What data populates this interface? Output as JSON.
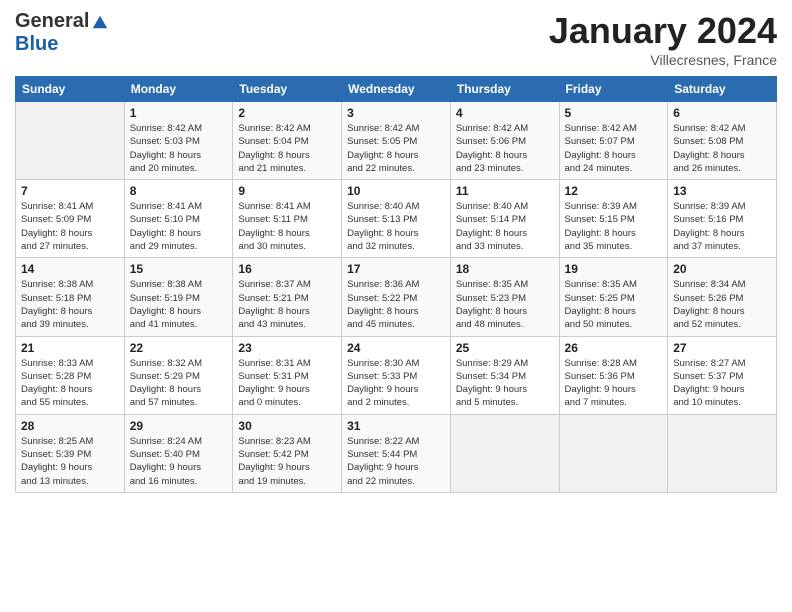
{
  "header": {
    "logo_general": "General",
    "logo_blue": "Blue",
    "month_title": "January 2024",
    "location": "Villecresnes, France"
  },
  "days_of_week": [
    "Sunday",
    "Monday",
    "Tuesday",
    "Wednesday",
    "Thursday",
    "Friday",
    "Saturday"
  ],
  "weeks": [
    {
      "days": [
        {
          "number": "",
          "info": ""
        },
        {
          "number": "1",
          "info": "Sunrise: 8:42 AM\nSunset: 5:03 PM\nDaylight: 8 hours\nand 20 minutes."
        },
        {
          "number": "2",
          "info": "Sunrise: 8:42 AM\nSunset: 5:04 PM\nDaylight: 8 hours\nand 21 minutes."
        },
        {
          "number": "3",
          "info": "Sunrise: 8:42 AM\nSunset: 5:05 PM\nDaylight: 8 hours\nand 22 minutes."
        },
        {
          "number": "4",
          "info": "Sunrise: 8:42 AM\nSunset: 5:06 PM\nDaylight: 8 hours\nand 23 minutes."
        },
        {
          "number": "5",
          "info": "Sunrise: 8:42 AM\nSunset: 5:07 PM\nDaylight: 8 hours\nand 24 minutes."
        },
        {
          "number": "6",
          "info": "Sunrise: 8:42 AM\nSunset: 5:08 PM\nDaylight: 8 hours\nand 26 minutes."
        }
      ]
    },
    {
      "days": [
        {
          "number": "7",
          "info": "Sunrise: 8:41 AM\nSunset: 5:09 PM\nDaylight: 8 hours\nand 27 minutes."
        },
        {
          "number": "8",
          "info": "Sunrise: 8:41 AM\nSunset: 5:10 PM\nDaylight: 8 hours\nand 29 minutes."
        },
        {
          "number": "9",
          "info": "Sunrise: 8:41 AM\nSunset: 5:11 PM\nDaylight: 8 hours\nand 30 minutes."
        },
        {
          "number": "10",
          "info": "Sunrise: 8:40 AM\nSunset: 5:13 PM\nDaylight: 8 hours\nand 32 minutes."
        },
        {
          "number": "11",
          "info": "Sunrise: 8:40 AM\nSunset: 5:14 PM\nDaylight: 8 hours\nand 33 minutes."
        },
        {
          "number": "12",
          "info": "Sunrise: 8:39 AM\nSunset: 5:15 PM\nDaylight: 8 hours\nand 35 minutes."
        },
        {
          "number": "13",
          "info": "Sunrise: 8:39 AM\nSunset: 5:16 PM\nDaylight: 8 hours\nand 37 minutes."
        }
      ]
    },
    {
      "days": [
        {
          "number": "14",
          "info": "Sunrise: 8:38 AM\nSunset: 5:18 PM\nDaylight: 8 hours\nand 39 minutes."
        },
        {
          "number": "15",
          "info": "Sunrise: 8:38 AM\nSunset: 5:19 PM\nDaylight: 8 hours\nand 41 minutes."
        },
        {
          "number": "16",
          "info": "Sunrise: 8:37 AM\nSunset: 5:21 PM\nDaylight: 8 hours\nand 43 minutes."
        },
        {
          "number": "17",
          "info": "Sunrise: 8:36 AM\nSunset: 5:22 PM\nDaylight: 8 hours\nand 45 minutes."
        },
        {
          "number": "18",
          "info": "Sunrise: 8:35 AM\nSunset: 5:23 PM\nDaylight: 8 hours\nand 48 minutes."
        },
        {
          "number": "19",
          "info": "Sunrise: 8:35 AM\nSunset: 5:25 PM\nDaylight: 8 hours\nand 50 minutes."
        },
        {
          "number": "20",
          "info": "Sunrise: 8:34 AM\nSunset: 5:26 PM\nDaylight: 8 hours\nand 52 minutes."
        }
      ]
    },
    {
      "days": [
        {
          "number": "21",
          "info": "Sunrise: 8:33 AM\nSunset: 5:28 PM\nDaylight: 8 hours\nand 55 minutes."
        },
        {
          "number": "22",
          "info": "Sunrise: 8:32 AM\nSunset: 5:29 PM\nDaylight: 8 hours\nand 57 minutes."
        },
        {
          "number": "23",
          "info": "Sunrise: 8:31 AM\nSunset: 5:31 PM\nDaylight: 9 hours\nand 0 minutes."
        },
        {
          "number": "24",
          "info": "Sunrise: 8:30 AM\nSunset: 5:33 PM\nDaylight: 9 hours\nand 2 minutes."
        },
        {
          "number": "25",
          "info": "Sunrise: 8:29 AM\nSunset: 5:34 PM\nDaylight: 9 hours\nand 5 minutes."
        },
        {
          "number": "26",
          "info": "Sunrise: 8:28 AM\nSunset: 5:36 PM\nDaylight: 9 hours\nand 7 minutes."
        },
        {
          "number": "27",
          "info": "Sunrise: 8:27 AM\nSunset: 5:37 PM\nDaylight: 9 hours\nand 10 minutes."
        }
      ]
    },
    {
      "days": [
        {
          "number": "28",
          "info": "Sunrise: 8:25 AM\nSunset: 5:39 PM\nDaylight: 9 hours\nand 13 minutes."
        },
        {
          "number": "29",
          "info": "Sunrise: 8:24 AM\nSunset: 5:40 PM\nDaylight: 9 hours\nand 16 minutes."
        },
        {
          "number": "30",
          "info": "Sunrise: 8:23 AM\nSunset: 5:42 PM\nDaylight: 9 hours\nand 19 minutes."
        },
        {
          "number": "31",
          "info": "Sunrise: 8:22 AM\nSunset: 5:44 PM\nDaylight: 9 hours\nand 22 minutes."
        },
        {
          "number": "",
          "info": ""
        },
        {
          "number": "",
          "info": ""
        },
        {
          "number": "",
          "info": ""
        }
      ]
    }
  ]
}
